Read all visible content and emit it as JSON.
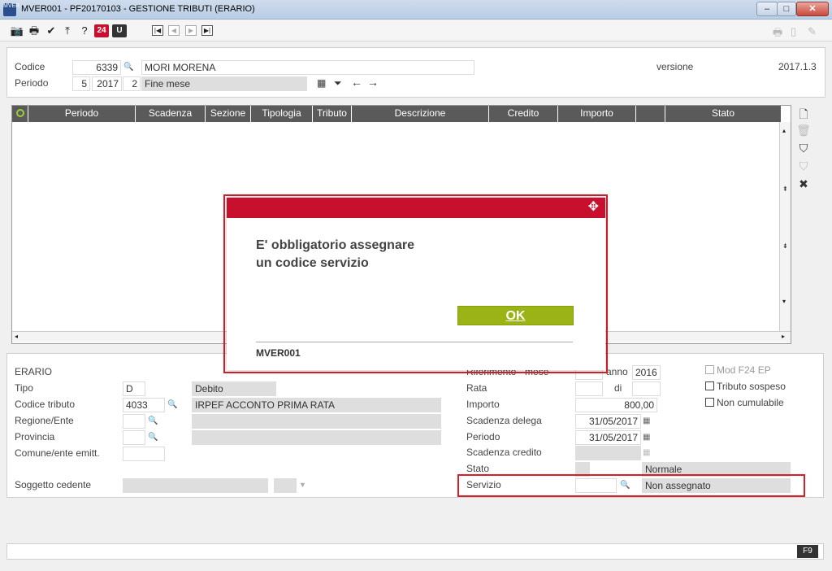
{
  "window": {
    "title": "MVER001 - PF20170103 - GESTIONE TRIBUTI (ERARIO)",
    "app_icon_text": "MVER",
    "minimize": "–",
    "maximize": "□",
    "close": "✕"
  },
  "toolbar": {
    "page24": "24",
    "exit_badge": "U"
  },
  "header": {
    "codice_label": "Codice",
    "codice_value": "6339",
    "nominativo": "MORI MORENA",
    "periodo_label": "Periodo",
    "periodo_num": "5",
    "periodo_anno": "2017",
    "periodo_tipo": "2",
    "periodo_desc": "Fine mese",
    "versione_label": "versione",
    "versione_value": "2017.1.3"
  },
  "grid": {
    "columns": [
      "Periodo",
      "Scadenza",
      "Sezione",
      "Tipologia",
      "Tributo",
      "Descrizione",
      "Credito",
      "Importo",
      "",
      "Stato"
    ]
  },
  "detail": {
    "section_title": "ERARIO",
    "tipo_label": "Tipo",
    "tipo_value": "D",
    "tipo_desc": "Debito",
    "codice_tributo_label": "Codice tributo",
    "codice_tributo_value": "4033",
    "codice_tributo_desc": "IRPEF ACCONTO  PRIMA RATA",
    "regione_label": "Regione/Ente",
    "provincia_label": "Provincia",
    "comune_label": "Comune/ente emitt.",
    "soggetto_label": "Soggetto cedente",
    "riferimento_label": "Riferimento - mese",
    "anno_label": "anno",
    "anno_value": "2016",
    "rata_label": "Rata",
    "di_label": "di",
    "importo_label": "Importo",
    "importo_value": "800,00",
    "scadenza_delega_label": "Scadenza delega",
    "scadenza_delega_value": "31/05/2017",
    "periodo_label": "Periodo",
    "periodo_value": "31/05/2017",
    "scadenza_credito_label": "Scadenza credito",
    "stato_label": "Stato",
    "stato_value": "Normale",
    "servizio_label": "Servizio",
    "servizio_value": "Non assegnato",
    "mod_f24_label": "Mod F24 EP",
    "tributo_sospeso_label": "Tributo sospeso",
    "non_cumulabile_label": "Non cumulabile"
  },
  "footer": {
    "f9": "F9"
  },
  "dialog": {
    "message_line1": "E' obbligatorio assegnare",
    "message_line2": "un codice servizio",
    "ok_label": "OK",
    "code": "MVER001"
  },
  "colors": {
    "accent": "#c8102e",
    "ok_button": "#9bb314",
    "highlight": "#d61f26",
    "grid_header": "#5a5a5a"
  }
}
